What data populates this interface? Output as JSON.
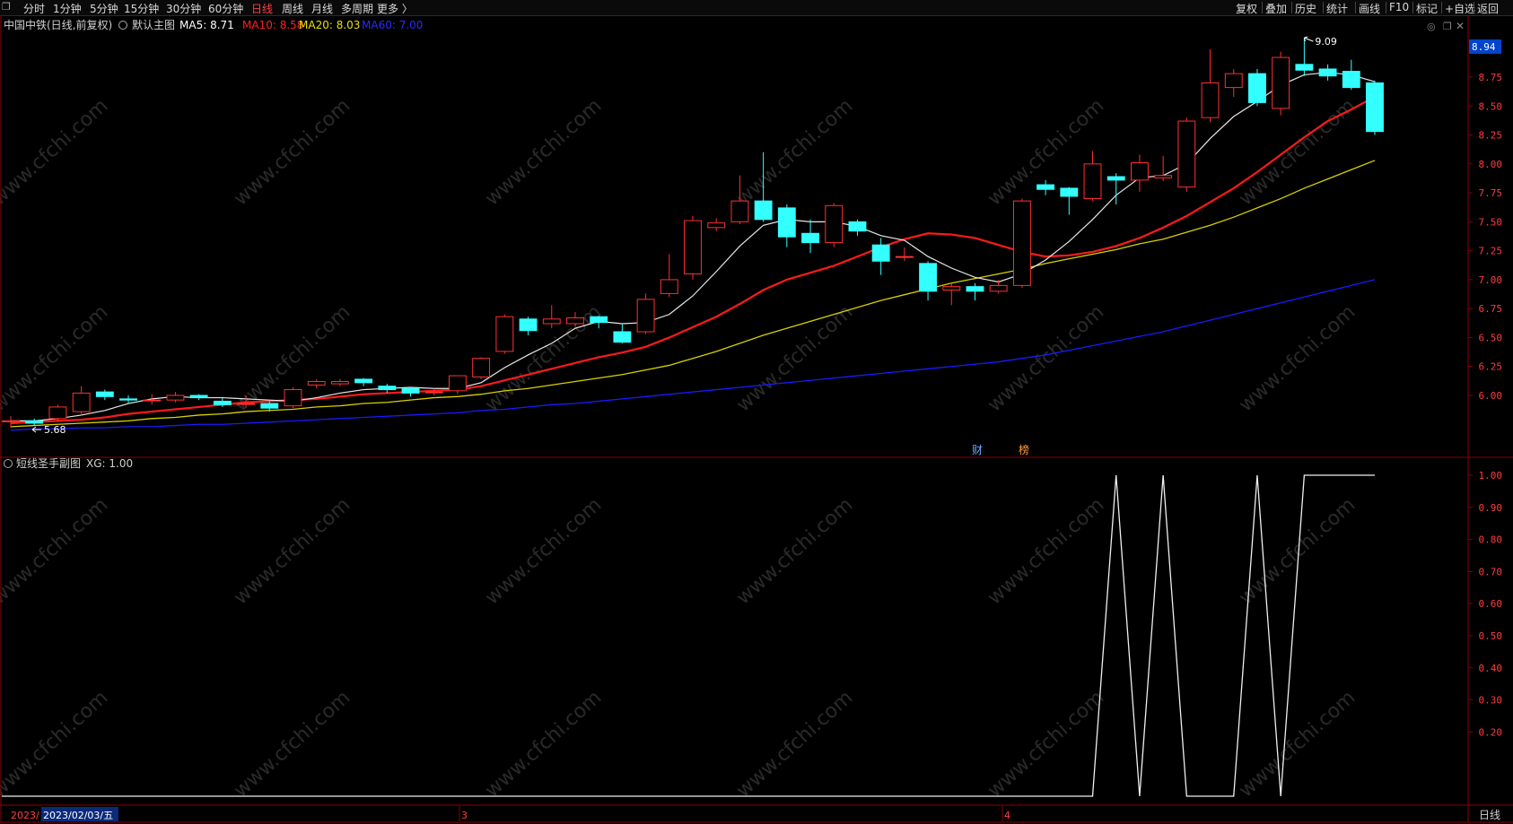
{
  "toolbar": {
    "window_icon": "window-restore-icon",
    "left_items": [
      "分时",
      "1分钟",
      "5分钟",
      "15分钟",
      "30分钟",
      "60分钟",
      "日线",
      "周线",
      "月线",
      "多周期",
      "更多 〉"
    ],
    "active_item": "日线",
    "right_items": [
      "复权",
      "叠加",
      "历史",
      "统计",
      "画线",
      "F10",
      "标记",
      "+自选",
      "返回"
    ]
  },
  "main_panel": {
    "title": "中国中铁(日线,前复权)",
    "indicator_name": "默认主图",
    "ma5": {
      "label": "MA5:",
      "value": "8.71",
      "color": "#ffffff"
    },
    "ma10": {
      "label": "MA10:",
      "value": "8.58",
      "color": "#ff2020"
    },
    "ma20": {
      "label": "MA20:",
      "value": "8.03",
      "color": "#e8e000"
    },
    "ma60": {
      "label": "MA60:",
      "value": "7.00",
      "color": "#2a2aff"
    },
    "price_tag": "8.94",
    "high_annotation": "9.09",
    "low_annotation": "5.68",
    "markers": [
      "财",
      "榜"
    ]
  },
  "sub_panel": {
    "title": "短线圣手副图",
    "xg_label": "XG:",
    "xg_value": "1.00"
  },
  "dates": {
    "year_fragment": "2023/",
    "cursor_date": "2023/02/03/五",
    "month_3": "3",
    "month_4": "4",
    "period_button": "日线"
  },
  "watermark": "www.cfchi.com",
  "chart_data": [
    {
      "type": "candlestick",
      "title": "中国中铁(日线,前复权)",
      "ylim": [
        5.6,
        9.2
      ],
      "y_ticks": [
        "6.00",
        "6.25",
        "6.50",
        "6.75",
        "7.00",
        "7.25",
        "7.50",
        "7.75",
        "8.00",
        "8.25",
        "8.50",
        "8.75"
      ],
      "candles": [
        {
          "o": 5.78,
          "h": 5.82,
          "l": 5.72,
          "c": 5.78
        },
        {
          "o": 5.78,
          "h": 5.8,
          "l": 5.74,
          "c": 5.76
        },
        {
          "o": 5.8,
          "h": 5.92,
          "l": 5.78,
          "c": 5.9
        },
        {
          "o": 5.86,
          "h": 6.08,
          "l": 5.84,
          "c": 6.02
        },
        {
          "o": 6.03,
          "h": 6.05,
          "l": 5.96,
          "c": 5.99
        },
        {
          "o": 5.97,
          "h": 6.0,
          "l": 5.93,
          "c": 5.96
        },
        {
          "o": 5.96,
          "h": 6.01,
          "l": 5.92,
          "c": 5.96
        },
        {
          "o": 5.96,
          "h": 6.03,
          "l": 5.94,
          "c": 6.0
        },
        {
          "o": 6.0,
          "h": 6.01,
          "l": 5.96,
          "c": 5.98
        },
        {
          "o": 5.95,
          "h": 5.98,
          "l": 5.9,
          "c": 5.92
        },
        {
          "o": 5.93,
          "h": 6.0,
          "l": 5.89,
          "c": 5.93
        },
        {
          "o": 5.93,
          "h": 5.95,
          "l": 5.86,
          "c": 5.89
        },
        {
          "o": 5.91,
          "h": 6.07,
          "l": 5.89,
          "c": 6.05
        },
        {
          "o": 6.09,
          "h": 6.14,
          "l": 6.06,
          "c": 6.12
        },
        {
          "o": 6.1,
          "h": 6.14,
          "l": 6.08,
          "c": 6.12
        },
        {
          "o": 6.14,
          "h": 6.15,
          "l": 6.08,
          "c": 6.11
        },
        {
          "o": 6.08,
          "h": 6.1,
          "l": 6.02,
          "c": 6.05
        },
        {
          "o": 6.06,
          "h": 6.07,
          "l": 5.99,
          "c": 6.02
        },
        {
          "o": 6.03,
          "h": 6.06,
          "l": 6.0,
          "c": 6.03
        },
        {
          "o": 6.04,
          "h": 6.17,
          "l": 6.01,
          "c": 6.17
        },
        {
          "o": 6.16,
          "h": 6.33,
          "l": 6.14,
          "c": 6.32
        },
        {
          "o": 6.38,
          "h": 6.7,
          "l": 6.36,
          "c": 6.68
        },
        {
          "o": 6.66,
          "h": 6.68,
          "l": 6.52,
          "c": 6.56
        },
        {
          "o": 6.62,
          "h": 6.78,
          "l": 6.58,
          "c": 6.66
        },
        {
          "o": 6.62,
          "h": 6.72,
          "l": 6.6,
          "c": 6.67
        },
        {
          "o": 6.68,
          "h": 6.69,
          "l": 6.58,
          "c": 6.63
        },
        {
          "o": 6.55,
          "h": 6.62,
          "l": 6.45,
          "c": 6.46
        },
        {
          "o": 6.55,
          "h": 6.88,
          "l": 6.53,
          "c": 6.83
        },
        {
          "o": 6.88,
          "h": 7.22,
          "l": 6.85,
          "c": 7.0
        },
        {
          "o": 7.05,
          "h": 7.55,
          "l": 7.0,
          "c": 7.51
        },
        {
          "o": 7.45,
          "h": 7.53,
          "l": 7.42,
          "c": 7.49
        },
        {
          "o": 7.5,
          "h": 7.9,
          "l": 7.48,
          "c": 7.68
        },
        {
          "o": 7.68,
          "h": 8.1,
          "l": 7.5,
          "c": 7.52
        },
        {
          "o": 7.62,
          "h": 7.65,
          "l": 7.28,
          "c": 7.37
        },
        {
          "o": 7.4,
          "h": 7.52,
          "l": 7.23,
          "c": 7.32
        },
        {
          "o": 7.32,
          "h": 7.66,
          "l": 7.28,
          "c": 7.64
        },
        {
          "o": 7.5,
          "h": 7.52,
          "l": 7.38,
          "c": 7.42
        },
        {
          "o": 7.3,
          "h": 7.36,
          "l": 7.04,
          "c": 7.16
        },
        {
          "o": 7.2,
          "h": 7.28,
          "l": 7.16,
          "c": 7.2
        },
        {
          "o": 7.14,
          "h": 7.16,
          "l": 6.82,
          "c": 6.9
        },
        {
          "o": 6.91,
          "h": 6.97,
          "l": 6.78,
          "c": 6.94
        },
        {
          "o": 6.94,
          "h": 6.97,
          "l": 6.82,
          "c": 6.9
        },
        {
          "o": 6.9,
          "h": 7.0,
          "l": 6.88,
          "c": 6.95
        },
        {
          "o": 6.95,
          "h": 7.7,
          "l": 6.93,
          "c": 7.68
        },
        {
          "o": 7.82,
          "h": 7.86,
          "l": 7.73,
          "c": 7.78
        },
        {
          "o": 7.79,
          "h": 7.8,
          "l": 7.56,
          "c": 7.72
        },
        {
          "o": 7.7,
          "h": 8.11,
          "l": 7.68,
          "c": 8.0
        },
        {
          "o": 7.89,
          "h": 7.92,
          "l": 7.65,
          "c": 7.86
        },
        {
          "o": 7.86,
          "h": 8.08,
          "l": 7.76,
          "c": 8.01
        },
        {
          "o": 7.88,
          "h": 8.07,
          "l": 7.85,
          "c": 7.9
        },
        {
          "o": 7.8,
          "h": 8.4,
          "l": 7.76,
          "c": 8.37
        },
        {
          "o": 8.4,
          "h": 8.99,
          "l": 8.36,
          "c": 8.7
        },
        {
          "o": 8.66,
          "h": 8.82,
          "l": 8.58,
          "c": 8.78
        },
        {
          "o": 8.78,
          "h": 8.82,
          "l": 8.5,
          "c": 8.53
        },
        {
          "o": 8.48,
          "h": 8.97,
          "l": 8.42,
          "c": 8.92
        },
        {
          "o": 8.86,
          "h": 9.09,
          "l": 8.76,
          "c": 8.81
        },
        {
          "o": 8.82,
          "h": 8.86,
          "l": 8.72,
          "c": 8.76
        },
        {
          "o": 8.8,
          "h": 8.9,
          "l": 8.64,
          "c": 8.66
        },
        {
          "o": 8.7,
          "h": 8.72,
          "l": 8.25,
          "c": 8.28
        }
      ],
      "ma5": [
        5.78,
        5.78,
        5.8,
        5.83,
        5.87,
        5.93,
        5.97,
        5.99,
        5.98,
        5.98,
        5.97,
        5.96,
        5.95,
        5.98,
        6.02,
        6.05,
        6.06,
        6.07,
        6.06,
        6.06,
        6.11,
        6.24,
        6.35,
        6.45,
        6.58,
        6.64,
        6.62,
        6.63,
        6.7,
        6.86,
        7.07,
        7.29,
        7.47,
        7.52,
        7.5,
        7.5,
        7.46,
        7.38,
        7.34,
        7.2,
        7.1,
        7.02,
        6.98,
        7.05,
        7.17,
        7.33,
        7.52,
        7.73,
        7.88,
        7.9,
        8.0,
        8.22,
        8.41,
        8.54,
        8.68,
        8.77,
        8.79,
        8.77,
        8.71
      ],
      "ma10": [
        5.76,
        5.77,
        5.78,
        5.79,
        5.81,
        5.84,
        5.86,
        5.88,
        5.9,
        5.92,
        5.94,
        5.95,
        5.96,
        5.97,
        5.99,
        6.01,
        6.02,
        6.03,
        6.04,
        6.05,
        6.08,
        6.13,
        6.18,
        6.23,
        6.28,
        6.33,
        6.37,
        6.42,
        6.5,
        6.59,
        6.68,
        6.79,
        6.91,
        7.0,
        7.06,
        7.12,
        7.2,
        7.28,
        7.35,
        7.4,
        7.39,
        7.36,
        7.3,
        7.24,
        7.2,
        7.21,
        7.24,
        7.29,
        7.36,
        7.45,
        7.55,
        7.67,
        7.79,
        7.93,
        8.08,
        8.23,
        8.37,
        8.47,
        8.58
      ],
      "ma20": [
        5.73,
        5.74,
        5.75,
        5.76,
        5.77,
        5.78,
        5.8,
        5.81,
        5.83,
        5.84,
        5.86,
        5.87,
        5.88,
        5.9,
        5.91,
        5.93,
        5.94,
        5.96,
        5.98,
        5.99,
        6.01,
        6.04,
        6.06,
        6.09,
        6.12,
        6.15,
        6.18,
        6.22,
        6.26,
        6.32,
        6.38,
        6.45,
        6.52,
        6.58,
        6.64,
        6.7,
        6.76,
        6.82,
        6.87,
        6.92,
        6.97,
        7.01,
        7.05,
        7.09,
        7.14,
        7.18,
        7.22,
        7.26,
        7.31,
        7.35,
        7.41,
        7.47,
        7.54,
        7.62,
        7.7,
        7.79,
        7.87,
        7.95,
        8.03
      ],
      "ma60": [
        5.7,
        5.71,
        5.71,
        5.72,
        5.72,
        5.73,
        5.73,
        5.74,
        5.75,
        5.75,
        5.76,
        5.77,
        5.78,
        5.79,
        5.8,
        5.81,
        5.82,
        5.83,
        5.84,
        5.85,
        5.87,
        5.88,
        5.9,
        5.92,
        5.93,
        5.95,
        5.97,
        5.99,
        6.01,
        6.03,
        6.05,
        6.07,
        6.09,
        6.11,
        6.13,
        6.15,
        6.17,
        6.19,
        6.21,
        6.23,
        6.25,
        6.27,
        6.29,
        6.32,
        6.35,
        6.39,
        6.43,
        6.47,
        6.51,
        6.55,
        6.6,
        6.65,
        6.7,
        6.75,
        6.8,
        6.85,
        6.9,
        6.95,
        7.0
      ]
    },
    {
      "type": "line",
      "title": "短线圣手副图",
      "ylim": [
        0.0,
        1.05
      ],
      "y_ticks": [
        "0.20",
        "0.30",
        "0.40",
        "0.50",
        "0.60",
        "0.70",
        "0.80",
        "0.90",
        "1.00"
      ],
      "series": [
        {
          "name": "XG",
          "values": [
            0,
            0,
            0,
            0,
            0,
            0,
            0,
            0,
            0,
            0,
            0,
            0,
            0,
            0,
            0,
            0,
            0,
            0,
            0,
            0,
            0,
            0,
            0,
            0,
            0,
            0,
            0,
            0,
            0,
            0,
            0,
            0,
            0,
            0,
            0,
            0,
            0,
            0,
            0,
            0,
            0,
            0,
            0,
            0,
            0,
            0,
            0,
            1,
            0,
            1,
            0,
            0,
            0,
            1,
            0,
            1,
            1,
            1,
            1
          ]
        }
      ]
    }
  ]
}
